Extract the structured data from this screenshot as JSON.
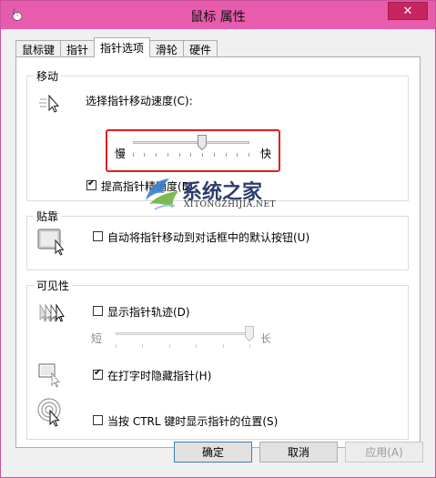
{
  "window": {
    "title": "鼠标 属性",
    "close_glyph": "✕",
    "titlebar_color": "#e85cad",
    "close_color": "#c7255e"
  },
  "tabs": [
    {
      "label": "鼠标键",
      "active": false
    },
    {
      "label": "指针",
      "active": false
    },
    {
      "label": "指针选项",
      "active": true
    },
    {
      "label": "滑轮",
      "active": false
    },
    {
      "label": "硬件",
      "active": false
    }
  ],
  "motion": {
    "group_title": "移动",
    "speed_label": "选择指针移动速度(C):",
    "slow_label": "慢",
    "fast_label": "快",
    "speed_value": 0.6,
    "precision_label": "提高指针精确度(E)",
    "precision_checked": true,
    "highlight_color": "#e0201c"
  },
  "snap": {
    "group_title": "贴靠",
    "snap_label": "自动将指针移动到对话框中的默认按钮(U)",
    "snap_checked": false
  },
  "visibility": {
    "group_title": "可见性",
    "trails_label": "显示指针轨迹(D)",
    "trails_checked": false,
    "short_label": "短",
    "long_label": "长",
    "trail_length_value": 1.0,
    "hide_typing_label": "在打字时隐藏指针(H)",
    "hide_typing_checked": true,
    "ctrl_label": "当按 CTRL 键时显示指针的位置(S)",
    "ctrl_checked": false
  },
  "buttons": {
    "ok": "确定",
    "cancel": "取消",
    "apply": "应用(A)"
  },
  "watermark": {
    "title": "系统之家",
    "subtitle": "XITONGZHIJIA.NET"
  }
}
